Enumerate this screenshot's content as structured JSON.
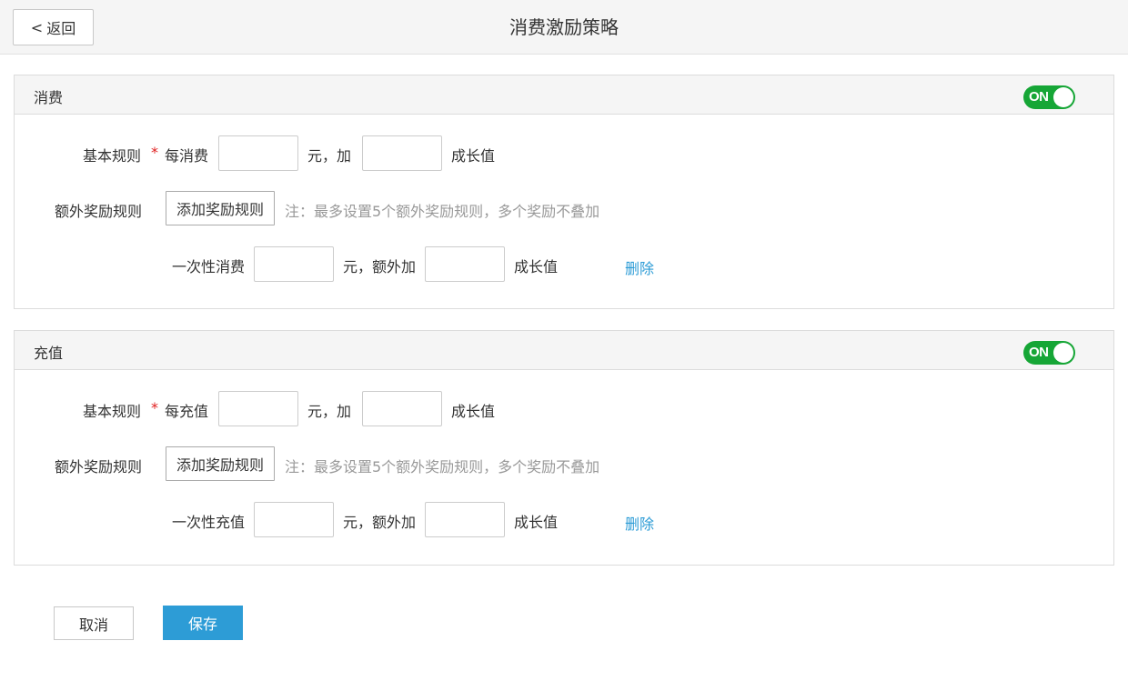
{
  "header": {
    "back_chevron": "<",
    "back_label": "返回",
    "title": "消费激励策略"
  },
  "toggle_color": "#16a636",
  "accent_color": "#2d9cd6",
  "sections": [
    {
      "title": "消费",
      "toggle_label": "ON",
      "basic_rule_label": "基本规则",
      "required_mark": "*",
      "per_label": "每消费",
      "per_value": "",
      "unit_add_label": "元，加",
      "add_value": "",
      "growth_label": "成长值",
      "extra_rule_label": "额外奖励规则",
      "add_rule_button": "添加奖励规则",
      "note": "注：最多设置5个额外奖励规则，多个奖励不叠加",
      "extra_rule": {
        "once_label": "一次性消费",
        "once_value": "",
        "extra_add_label": "元，额外加",
        "extra_value": "",
        "growth_label": "成长值",
        "delete_label": "删除"
      }
    },
    {
      "title": "充值",
      "toggle_label": "ON",
      "basic_rule_label": "基本规则",
      "required_mark": "*",
      "per_label": "每充值",
      "per_value": "",
      "unit_add_label": "元，加",
      "add_value": "",
      "growth_label": "成长值",
      "extra_rule_label": "额外奖励规则",
      "add_rule_button": "添加奖励规则",
      "note": "注：最多设置5个额外奖励规则，多个奖励不叠加",
      "extra_rule": {
        "once_label": "一次性充值",
        "once_value": "",
        "extra_add_label": "元，额外加",
        "extra_value": "",
        "growth_label": "成长值",
        "delete_label": "删除"
      }
    }
  ],
  "footer": {
    "cancel_label": "取消",
    "save_label": "保存"
  }
}
